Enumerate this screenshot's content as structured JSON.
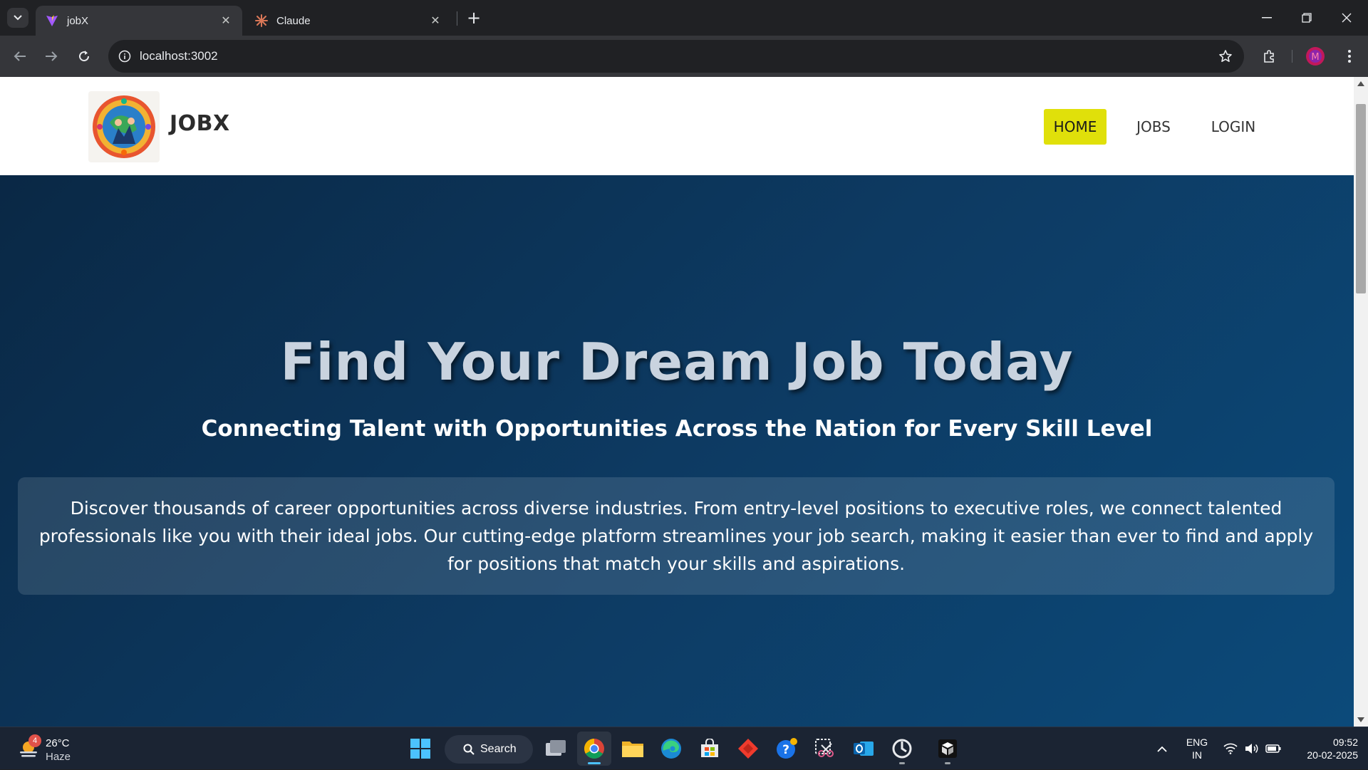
{
  "browser": {
    "tabs": [
      {
        "title": "jobX",
        "active": true,
        "favicon": "vite-icon"
      },
      {
        "title": "Claude",
        "active": false,
        "favicon": "claude-icon"
      }
    ],
    "url": "localhost:3002"
  },
  "site": {
    "brand": "JOBX",
    "nav": [
      {
        "label": "HOME",
        "active": true
      },
      {
        "label": "JOBS",
        "active": false
      },
      {
        "label": "LOGIN",
        "active": false
      }
    ],
    "accent_color": "#e0e00a"
  },
  "hero": {
    "title": "Find Your Dream Job Today",
    "subtitle": "Connecting Talent with Opportunities Across the Nation for Every Skill Level",
    "description": "Discover thousands of career opportunities across diverse industries. From entry-level positions to executive roles, we connect talented professionals like you with their ideal jobs. Our cutting-edge platform streamlines your job search, making it easier than ever to find and apply for positions that match your skills and aspirations."
  },
  "taskbar": {
    "weather": {
      "temp": "26°C",
      "condition": "Haze",
      "badge": "4"
    },
    "search_label": "Search",
    "language": {
      "line1": "ENG",
      "line2": "IN"
    },
    "time": "09:52",
    "date": "20-02-2025"
  }
}
